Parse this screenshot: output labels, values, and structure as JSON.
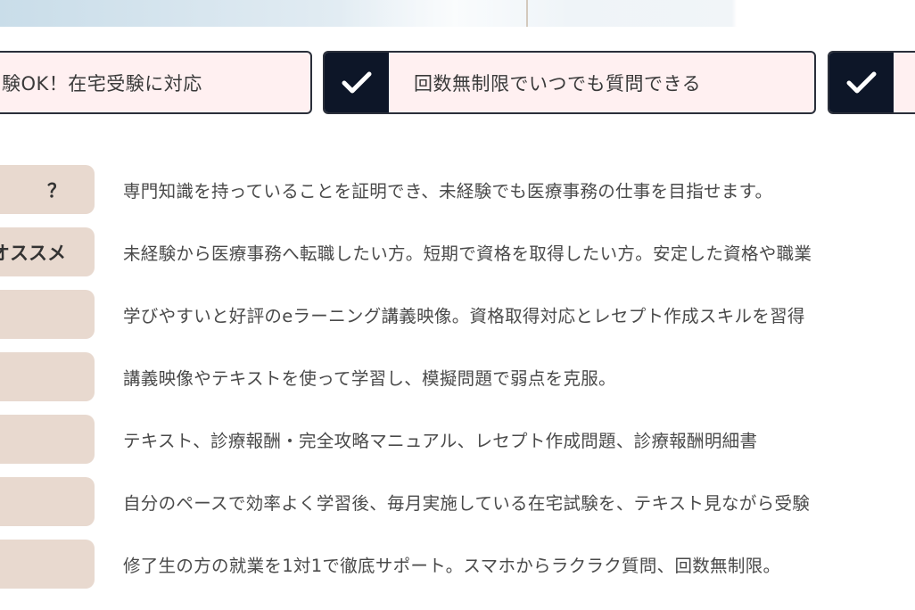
{
  "features": [
    {
      "text": "験OK！在宅受験に対応",
      "checked": false
    },
    {
      "text": "回数無制限でいつでも質問できる",
      "checked": true
    },
    {
      "text": "",
      "checked": true
    }
  ],
  "rows": [
    {
      "label": "？",
      "text": "専門知識を持っていることを証明でき、未経験でも医療事務の仕事を目指せます。"
    },
    {
      "label": "オススメ",
      "text": "未経験から医療事務へ転職したい方。短期で資格を取得したい方。安定した資格や職業"
    },
    {
      "label": "",
      "text": "学びやすいと好評のeラーニング講義映像。資格取得対応とレセプト作成スキルを習得"
    },
    {
      "label": "",
      "text": "講義映像やテキストを使って学習し、模擬問題で弱点を克服。"
    },
    {
      "label": "",
      "text": "テキスト、診療報酬・完全攻略マニュアル、レセプト作成問題、診療報酬明細書"
    },
    {
      "label": "",
      "text": "自分のペースで効率よく学習後、毎月実施している在宅試験を、テキスト見ながら受験"
    },
    {
      "label": "",
      "text": "修了生の方の就業を1対1で徹底サポート。スマホからラクラク質問、回数無制限。"
    }
  ],
  "colors": {
    "check_bg": "#0d1628",
    "feature_bg": "#fff0f1",
    "label_bg": "#e8d9cf"
  }
}
